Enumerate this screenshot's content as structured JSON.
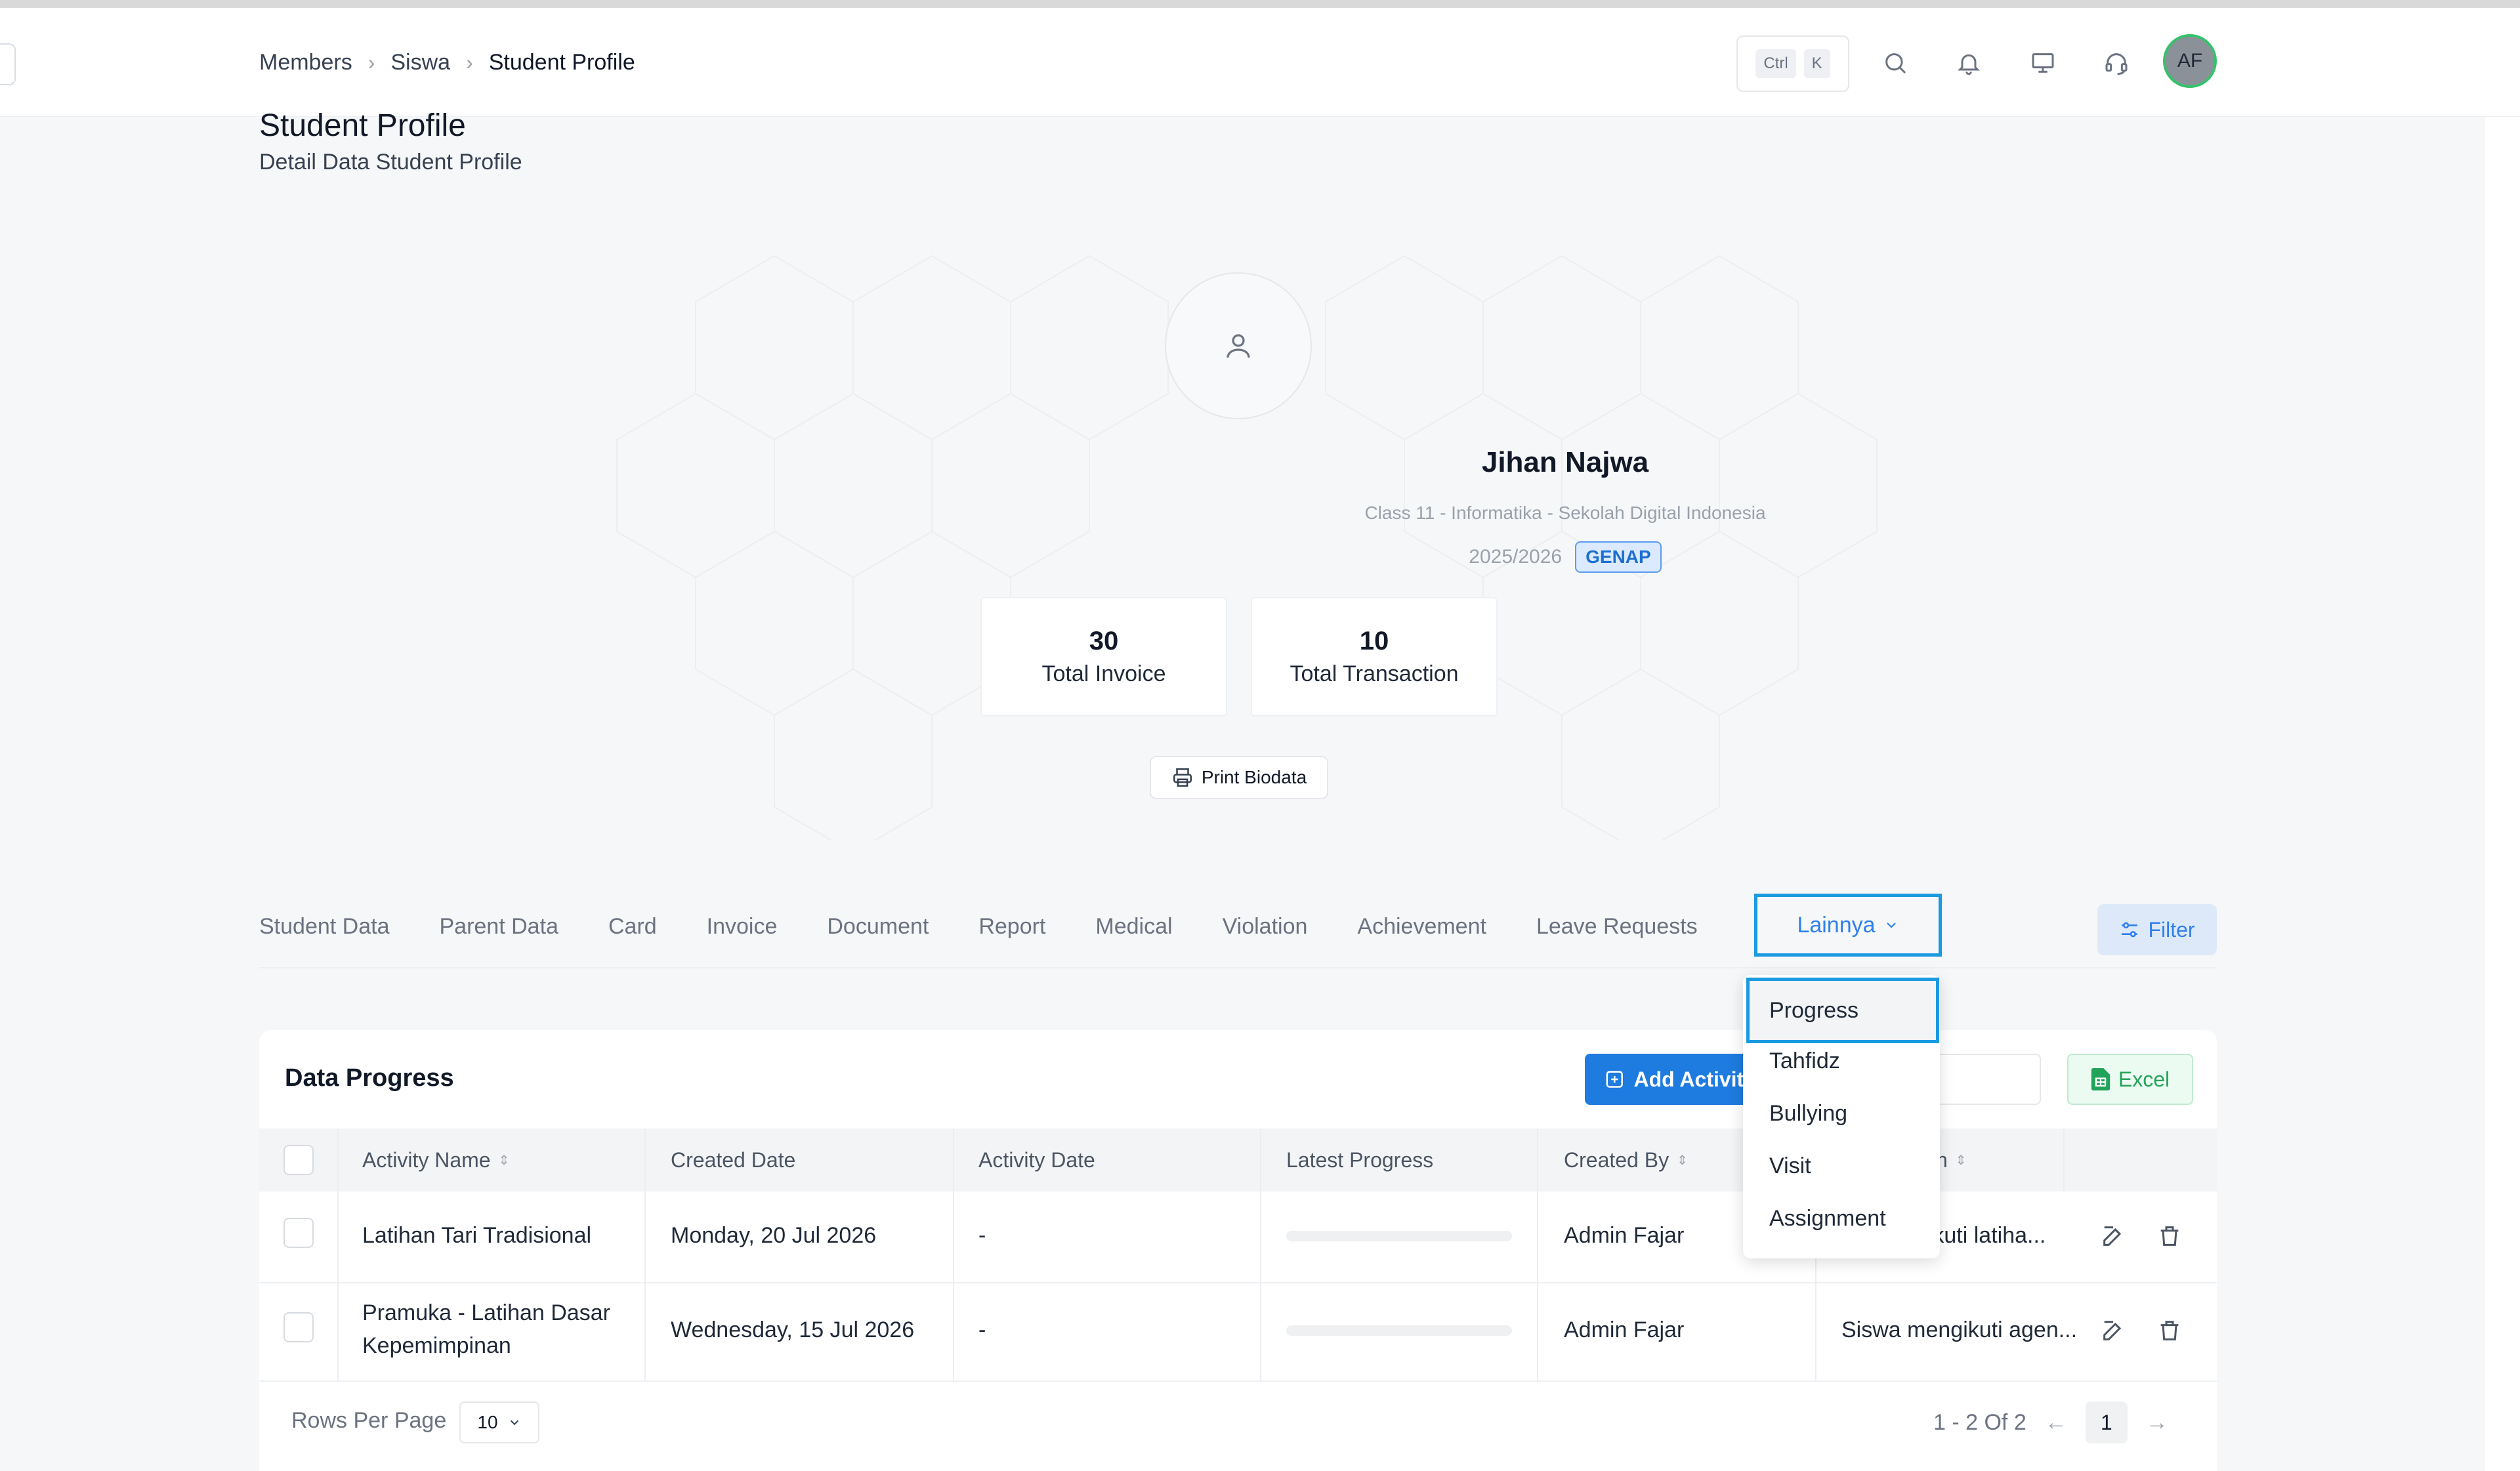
{
  "breadcrumb": [
    "Members",
    "Siswa",
    "Student Profile"
  ],
  "header": {
    "kbd_ctrl": "Ctrl",
    "kbd_k": "K",
    "avatar_initials": "AF"
  },
  "page": {
    "title": "Student Profile",
    "subtitle": "Detail Data Student Profile"
  },
  "profile": {
    "name": "Jihan Najwa",
    "class_info": "Class 11 - Informatika - Sekolah Digital Indonesia",
    "year": "2025/2026",
    "semester_badge": "GENAP",
    "stats": [
      {
        "value": "30",
        "label": "Total Invoice"
      },
      {
        "value": "10",
        "label": "Total Transaction"
      }
    ],
    "print_label": "Print Biodata"
  },
  "tabs": [
    "Student Data",
    "Parent Data",
    "Card",
    "Invoice",
    "Document",
    "Report",
    "Medical",
    "Violation",
    "Achievement",
    "Leave Requests"
  ],
  "tab_more": "Lainnya",
  "filter_label": "Filter",
  "dropdown": {
    "items": [
      "Progress",
      "Tahfidz",
      "Bullying",
      "Visit",
      "Assignment"
    ]
  },
  "table": {
    "title": "Data Progress",
    "add_label": "Add Activity",
    "excel_label": "Excel",
    "columns": [
      "Activity Name",
      "Created Date",
      "Activity Date",
      "Latest Progress",
      "Created By",
      "n"
    ],
    "rows": [
      {
        "activity_name": "Latihan Tari Tradisional",
        "activity_name_2": "",
        "created_date": "Monday, 20 Jul 2026",
        "activity_date": "-",
        "progress": 0,
        "created_by": "Admin Fajar",
        "description": "ngikuti latiha..."
      },
      {
        "activity_name": "Pramuka - Latihan Dasar",
        "activity_name_2": "Kepemimpinan",
        "created_date": "Wednesday, 15 Jul 2026",
        "activity_date": "-",
        "progress": 0,
        "created_by": "Admin Fajar",
        "description": "Siswa mengikuti agen..."
      }
    ],
    "rows_per_page_label": "Rows Per Page",
    "rows_per_page_value": "10",
    "pagination_info": "1 - 2 Of 2",
    "current_page": "1"
  }
}
